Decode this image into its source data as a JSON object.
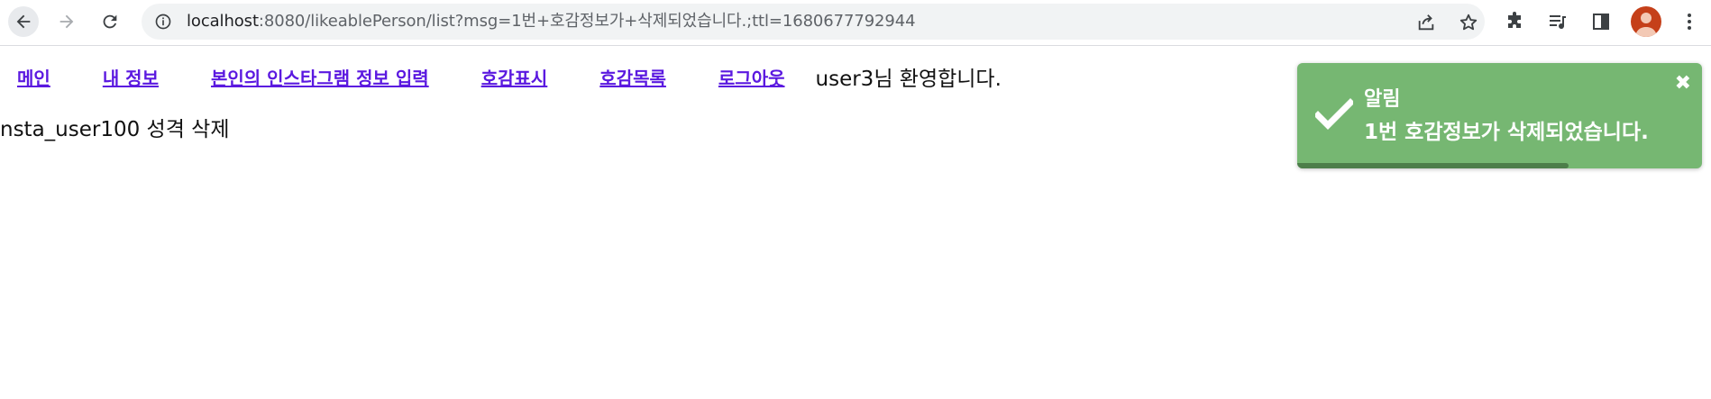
{
  "browser": {
    "url_host": "localhost",
    "url_rest": ":8080/likeablePerson/list?msg=1번+호감정보가+삭제되었습니다.;ttl=1680677792944",
    "icons": [
      "back-arrow-icon",
      "forward-arrow-icon",
      "reload-icon",
      "site-info-icon",
      "share-icon",
      "star-icon",
      "extensions-icon",
      "media-icon",
      "side-panel-icon",
      "profile-avatar",
      "menu-icon"
    ]
  },
  "nav": {
    "links": [
      "메인",
      "내 정보",
      "본인의 인스타그램 정보 입력",
      "호감표시",
      "호감목록",
      "로그아웃"
    ],
    "welcome": "user3님 환영합니다."
  },
  "content": {
    "item": "nsta_user100 성격 삭제"
  },
  "toast": {
    "title": "알림",
    "message": "1번 호감정보가 삭제되었습니다.",
    "close_glyph": "✖",
    "progress_fraction": 0.67,
    "color": "#76b772"
  }
}
